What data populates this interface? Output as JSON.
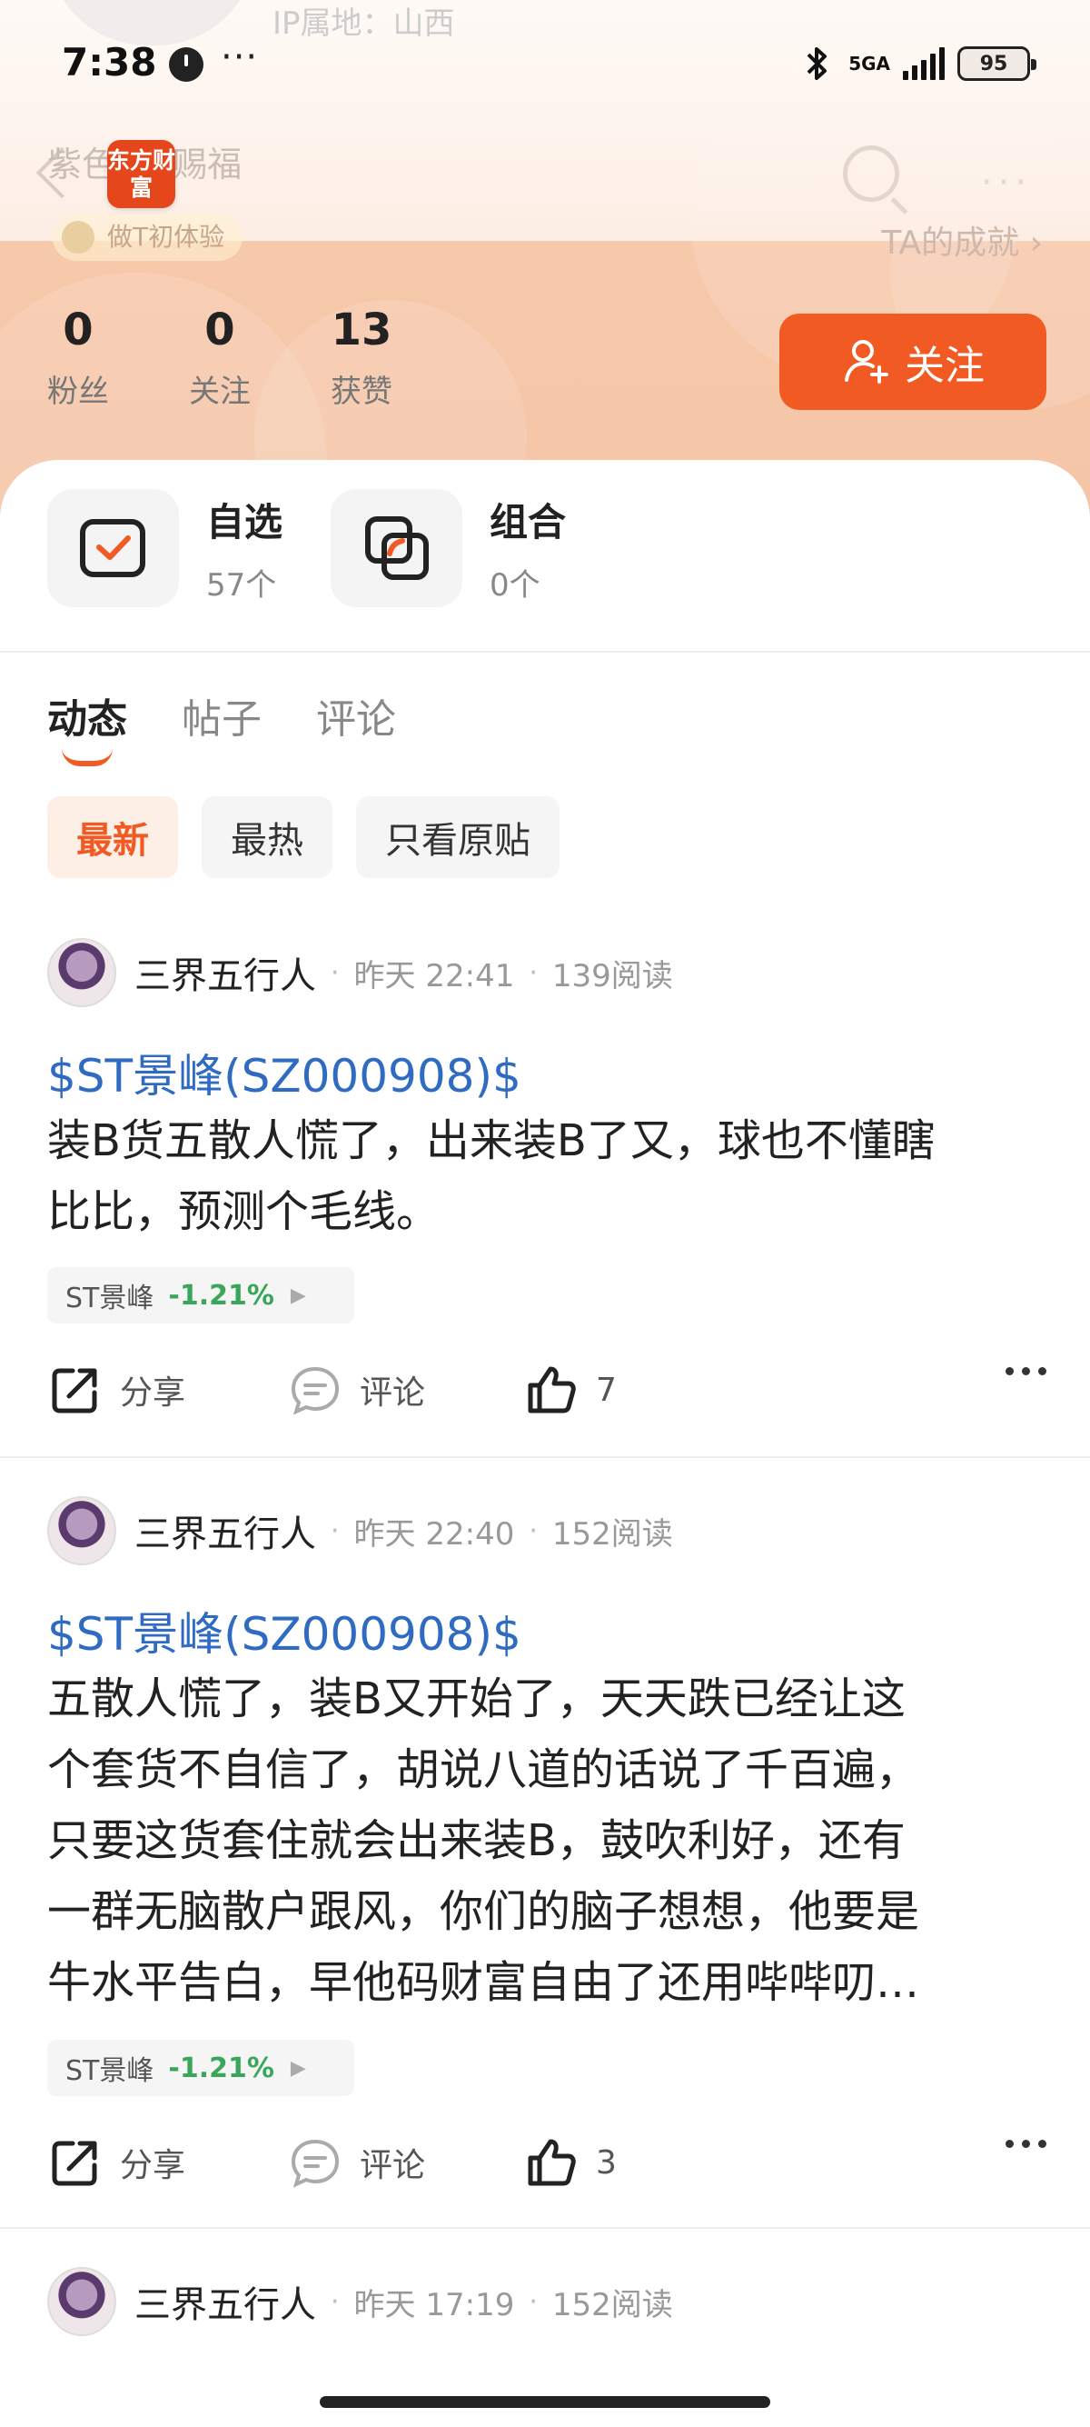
{
  "status_bar": {
    "time": "7:38",
    "dots": "···",
    "network": "5GA",
    "battery": "95"
  },
  "header": {
    "ip_location": "IP属地：山西",
    "nickname": "紫色 … 赐福",
    "badge": "做T初体验",
    "achievement_link": "TA的成就 ›",
    "logo_text": "东方财富"
  },
  "stats": [
    {
      "value": "0",
      "label": "粉丝"
    },
    {
      "value": "0",
      "label": "关注"
    },
    {
      "value": "13",
      "label": "获赞"
    }
  ],
  "follow_button": "关注",
  "quick_links": [
    {
      "title": "自选",
      "count": "57个"
    },
    {
      "title": "组合",
      "count": "0个"
    }
  ],
  "tabs": [
    "动态",
    "帖子",
    "评论"
  ],
  "filters": [
    "最新",
    "最热",
    "只看原贴"
  ],
  "posts": [
    {
      "author": "三界五行人",
      "time": "昨天 22:41",
      "reads": "139阅读",
      "stock_link": "$ST景峰(SZ000908)$",
      "text_lines": [
        "装B货五散人慌了，出来装B了又，球也不懂瞎",
        "比比，预测个毛线。"
      ],
      "chip_name": "ST景峰",
      "chip_change": "-1.21%",
      "share": "分享",
      "comment": "评论",
      "likes": "7"
    },
    {
      "author": "三界五行人",
      "time": "昨天 22:40",
      "reads": "152阅读",
      "stock_link": "$ST景峰(SZ000908)$",
      "text_lines": [
        "五散人慌了，装B又开始了，天天跌已经让这",
        "个套货不自信了，胡说八道的话说了千百遍，",
        "只要这货套住就会出来装B，鼓吹利好，还有",
        "一群无脑散户跟风，你们的脑子想想，他要是",
        "牛水平告白，早他码财富自由了还用哔哔叨…"
      ],
      "chip_name": "ST景峰",
      "chip_change": "-1.21%",
      "share": "分享",
      "comment": "评论",
      "likes": "3"
    },
    {
      "author": "三界五行人",
      "time": "昨天 17:19",
      "reads": "152阅读"
    }
  ],
  "colors": {
    "accent": "#f15a22",
    "link": "#2f6bc2",
    "down": "#3aa65b"
  }
}
